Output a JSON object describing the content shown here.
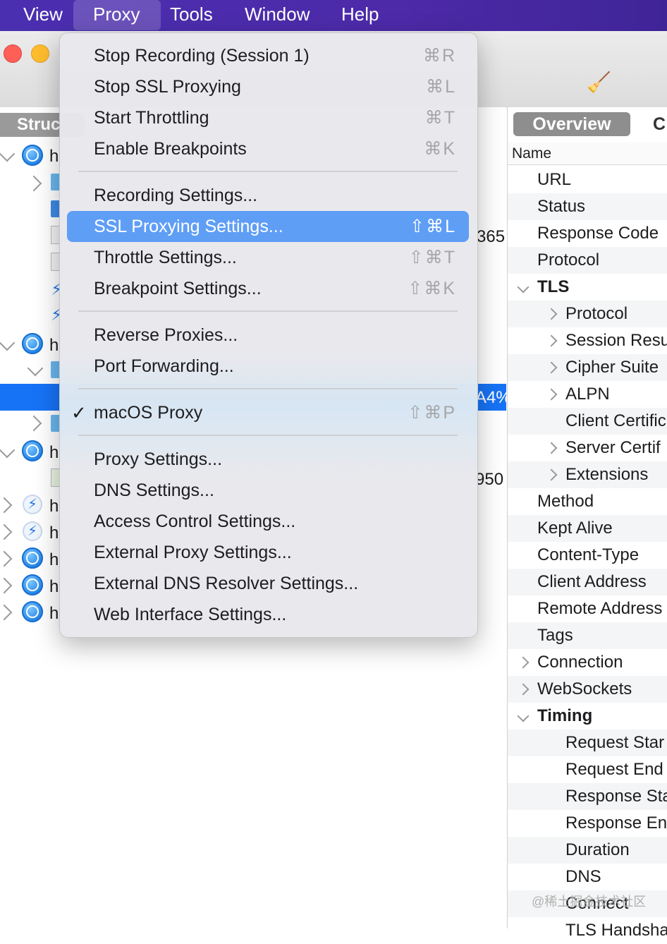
{
  "menubar": {
    "items": [
      "View",
      "Proxy",
      "Tools",
      "Window",
      "Help"
    ],
    "active": "Proxy"
  },
  "left": {
    "struct_tab": "Struc",
    "host_letter": "h",
    "row_texts": {
      "r1": "365",
      "selected": "A4%",
      "r2": "950"
    }
  },
  "inspector": {
    "tab_overview": "Overview",
    "tab_next": "C",
    "header": "Name",
    "rows": [
      {
        "label": "URL"
      },
      {
        "label": "Status"
      },
      {
        "label": "Response Code"
      },
      {
        "label": "Protocol"
      },
      {
        "label": "TLS"
      },
      {
        "label": "Protocol"
      },
      {
        "label": "Session Resu"
      },
      {
        "label": "Cipher Suite"
      },
      {
        "label": "ALPN"
      },
      {
        "label": "Client Certific"
      },
      {
        "label": "Server Certif"
      },
      {
        "label": "Extensions"
      },
      {
        "label": "Method"
      },
      {
        "label": "Kept Alive"
      },
      {
        "label": "Content-Type"
      },
      {
        "label": "Client Address"
      },
      {
        "label": "Remote Address"
      },
      {
        "label": "Tags"
      },
      {
        "label": "Connection"
      },
      {
        "label": "WebSockets"
      },
      {
        "label": "Timing"
      },
      {
        "label": "Request Star"
      },
      {
        "label": "Request End"
      },
      {
        "label": "Response Sta"
      },
      {
        "label": "Response En"
      },
      {
        "label": "Duration"
      },
      {
        "label": "DNS"
      },
      {
        "label": "Connect"
      },
      {
        "label": "TLS Handsha"
      }
    ]
  },
  "dropdown": {
    "groups": [
      [
        {
          "label": "Stop Recording (Session 1)",
          "shortcut": "⌘R"
        },
        {
          "label": "Stop SSL Proxying",
          "shortcut": "⌘L"
        },
        {
          "label": "Start Throttling",
          "shortcut": "⌘T"
        },
        {
          "label": "Enable Breakpoints",
          "shortcut": "⌘K"
        }
      ],
      [
        {
          "label": "Recording Settings...",
          "shortcut": ""
        },
        {
          "label": "SSL Proxying Settings...",
          "shortcut": "⇧⌘L",
          "highlighted": true
        },
        {
          "label": "Throttle Settings...",
          "shortcut": "⇧⌘T"
        },
        {
          "label": "Breakpoint Settings...",
          "shortcut": "⇧⌘K"
        }
      ],
      [
        {
          "label": "Reverse Proxies...",
          "shortcut": ""
        },
        {
          "label": "Port Forwarding...",
          "shortcut": ""
        }
      ],
      [
        {
          "label": "macOS Proxy",
          "shortcut": "⇧⌘P",
          "checked": true
        }
      ],
      [
        {
          "label": "Proxy Settings...",
          "shortcut": ""
        },
        {
          "label": "DNS Settings...",
          "shortcut": ""
        },
        {
          "label": "Access Control Settings...",
          "shortcut": ""
        },
        {
          "label": "External Proxy Settings...",
          "shortcut": ""
        },
        {
          "label": "External DNS Resolver Settings...",
          "shortcut": ""
        },
        {
          "label": "Web Interface Settings...",
          "shortcut": ""
        }
      ]
    ],
    "check_glyph": "✓"
  },
  "watermark": "@稀土掘金技术社区",
  "colors": {
    "menubar": "#4a2fb0",
    "highlight": "#5f9ef5",
    "selection": "#1773f6"
  }
}
